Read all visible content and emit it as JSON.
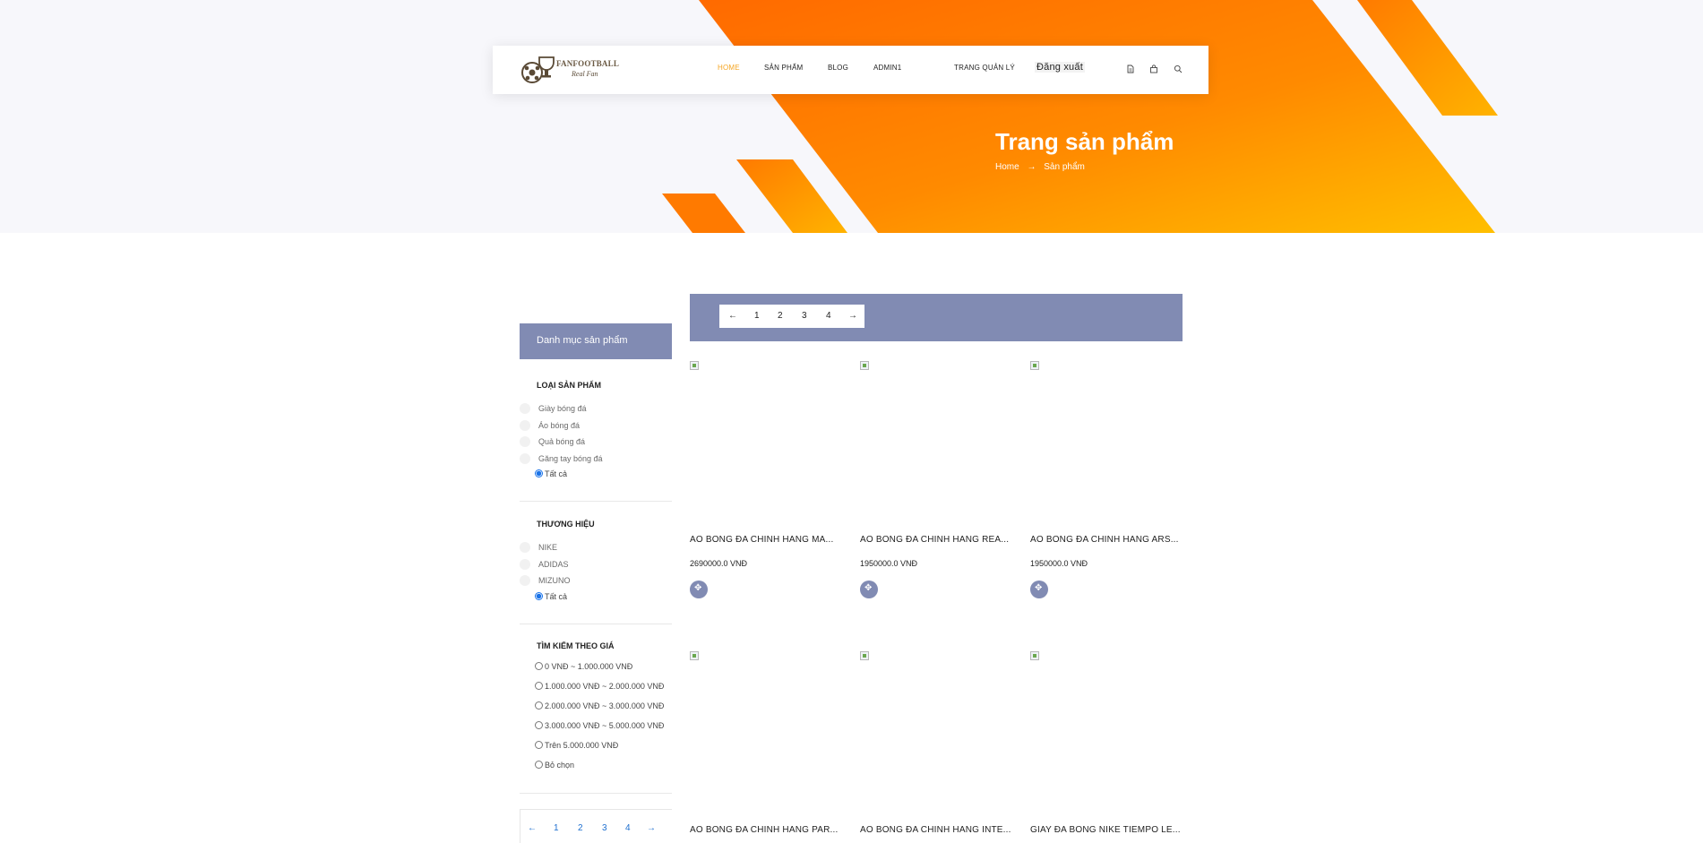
{
  "colors": {
    "accent": "#f5a623",
    "primary_strip": "#818bb3",
    "hero_orange": "#ff7300",
    "hero_yellow": "#ffbf00"
  },
  "header": {
    "logo": {
      "brand": "FANFOOTBALL",
      "script": "Real Fan"
    },
    "nav": {
      "home": "HOME",
      "products": "SẢN PHẨM",
      "blog": "BLOG",
      "user": "ADMIN1",
      "admin": "TRANG QUẢN LÝ",
      "logout": "Đăng xuất"
    },
    "icons": [
      "file-icon",
      "bag-icon",
      "search-icon"
    ]
  },
  "hero": {
    "title": "Trang sản phẩm",
    "breadcrumb": {
      "home": "Home",
      "arrow": "→",
      "current": "Sản phẩm"
    }
  },
  "sidebar": {
    "category_header": "Danh mục sản phẩm",
    "type_title": "LOẠI SẢN PHẨM",
    "types": [
      "Giày bóng đá",
      "Áo bóng đá",
      "Quả bóng đá",
      "Găng tay bóng đá"
    ],
    "type_all": "Tất cả",
    "brand_title": "THƯƠNG HIỆU",
    "brands": [
      "NIKE",
      "ADIDAS",
      "MIZUNO"
    ],
    "brand_all": "Tất cả",
    "price_title": "TÌM KIẾM THEO GIÁ",
    "prices": [
      "0 VNĐ ~ 1.000.000 VNĐ",
      "1.000.000 VNĐ ~ 2.000.000 VNĐ",
      "2.000.000 VNĐ ~ 3.000.000 VNĐ",
      "3.000.000 VNĐ ~ 5.000.000 VNĐ",
      "Trên 5.000.000 VNĐ",
      "Bỏ chọn"
    ]
  },
  "pagination": {
    "prev": "←",
    "pages": [
      "1",
      "2",
      "3",
      "4"
    ],
    "next": "→"
  },
  "products": [
    {
      "name": "AO BONG ĐA CHINH HANG MA...",
      "price": "2690000.0 VNĐ"
    },
    {
      "name": "AO BONG ĐA CHINH HANG REA...",
      "price": "1950000.0 VNĐ"
    },
    {
      "name": "AO BONG ĐA CHINH HANG ARS...",
      "price": "1950000.0 VNĐ"
    },
    {
      "name": "AO BONG ĐA CHINH HANG PAR...",
      "price": ""
    },
    {
      "name": "AO BONG ĐA CHINH HANG INTE...",
      "price": ""
    },
    {
      "name": "GIAY ĐA BONG NIKE TIEMPO LE...",
      "price": ""
    }
  ]
}
